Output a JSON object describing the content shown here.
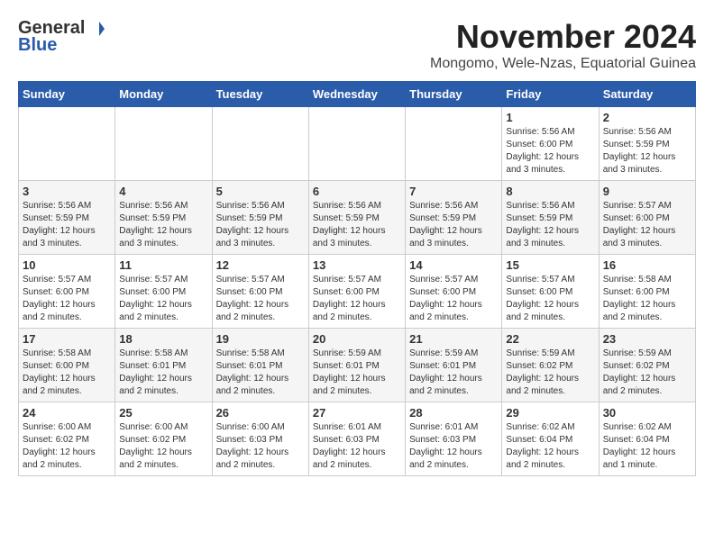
{
  "logo": {
    "general": "General",
    "blue": "Blue"
  },
  "header": {
    "month": "November 2024",
    "location": "Mongomo, Wele-Nzas, Equatorial Guinea"
  },
  "weekdays": [
    "Sunday",
    "Monday",
    "Tuesday",
    "Wednesday",
    "Thursday",
    "Friday",
    "Saturday"
  ],
  "weeks": [
    [
      {
        "day": "",
        "info": ""
      },
      {
        "day": "",
        "info": ""
      },
      {
        "day": "",
        "info": ""
      },
      {
        "day": "",
        "info": ""
      },
      {
        "day": "",
        "info": ""
      },
      {
        "day": "1",
        "info": "Sunrise: 5:56 AM\nSunset: 6:00 PM\nDaylight: 12 hours and 3 minutes."
      },
      {
        "day": "2",
        "info": "Sunrise: 5:56 AM\nSunset: 5:59 PM\nDaylight: 12 hours and 3 minutes."
      }
    ],
    [
      {
        "day": "3",
        "info": "Sunrise: 5:56 AM\nSunset: 5:59 PM\nDaylight: 12 hours and 3 minutes."
      },
      {
        "day": "4",
        "info": "Sunrise: 5:56 AM\nSunset: 5:59 PM\nDaylight: 12 hours and 3 minutes."
      },
      {
        "day": "5",
        "info": "Sunrise: 5:56 AM\nSunset: 5:59 PM\nDaylight: 12 hours and 3 minutes."
      },
      {
        "day": "6",
        "info": "Sunrise: 5:56 AM\nSunset: 5:59 PM\nDaylight: 12 hours and 3 minutes."
      },
      {
        "day": "7",
        "info": "Sunrise: 5:56 AM\nSunset: 5:59 PM\nDaylight: 12 hours and 3 minutes."
      },
      {
        "day": "8",
        "info": "Sunrise: 5:56 AM\nSunset: 5:59 PM\nDaylight: 12 hours and 3 minutes."
      },
      {
        "day": "9",
        "info": "Sunrise: 5:57 AM\nSunset: 6:00 PM\nDaylight: 12 hours and 3 minutes."
      }
    ],
    [
      {
        "day": "10",
        "info": "Sunrise: 5:57 AM\nSunset: 6:00 PM\nDaylight: 12 hours and 2 minutes."
      },
      {
        "day": "11",
        "info": "Sunrise: 5:57 AM\nSunset: 6:00 PM\nDaylight: 12 hours and 2 minutes."
      },
      {
        "day": "12",
        "info": "Sunrise: 5:57 AM\nSunset: 6:00 PM\nDaylight: 12 hours and 2 minutes."
      },
      {
        "day": "13",
        "info": "Sunrise: 5:57 AM\nSunset: 6:00 PM\nDaylight: 12 hours and 2 minutes."
      },
      {
        "day": "14",
        "info": "Sunrise: 5:57 AM\nSunset: 6:00 PM\nDaylight: 12 hours and 2 minutes."
      },
      {
        "day": "15",
        "info": "Sunrise: 5:57 AM\nSunset: 6:00 PM\nDaylight: 12 hours and 2 minutes."
      },
      {
        "day": "16",
        "info": "Sunrise: 5:58 AM\nSunset: 6:00 PM\nDaylight: 12 hours and 2 minutes."
      }
    ],
    [
      {
        "day": "17",
        "info": "Sunrise: 5:58 AM\nSunset: 6:00 PM\nDaylight: 12 hours and 2 minutes."
      },
      {
        "day": "18",
        "info": "Sunrise: 5:58 AM\nSunset: 6:01 PM\nDaylight: 12 hours and 2 minutes."
      },
      {
        "day": "19",
        "info": "Sunrise: 5:58 AM\nSunset: 6:01 PM\nDaylight: 12 hours and 2 minutes."
      },
      {
        "day": "20",
        "info": "Sunrise: 5:59 AM\nSunset: 6:01 PM\nDaylight: 12 hours and 2 minutes."
      },
      {
        "day": "21",
        "info": "Sunrise: 5:59 AM\nSunset: 6:01 PM\nDaylight: 12 hours and 2 minutes."
      },
      {
        "day": "22",
        "info": "Sunrise: 5:59 AM\nSunset: 6:02 PM\nDaylight: 12 hours and 2 minutes."
      },
      {
        "day": "23",
        "info": "Sunrise: 5:59 AM\nSunset: 6:02 PM\nDaylight: 12 hours and 2 minutes."
      }
    ],
    [
      {
        "day": "24",
        "info": "Sunrise: 6:00 AM\nSunset: 6:02 PM\nDaylight: 12 hours and 2 minutes."
      },
      {
        "day": "25",
        "info": "Sunrise: 6:00 AM\nSunset: 6:02 PM\nDaylight: 12 hours and 2 minutes."
      },
      {
        "day": "26",
        "info": "Sunrise: 6:00 AM\nSunset: 6:03 PM\nDaylight: 12 hours and 2 minutes."
      },
      {
        "day": "27",
        "info": "Sunrise: 6:01 AM\nSunset: 6:03 PM\nDaylight: 12 hours and 2 minutes."
      },
      {
        "day": "28",
        "info": "Sunrise: 6:01 AM\nSunset: 6:03 PM\nDaylight: 12 hours and 2 minutes."
      },
      {
        "day": "29",
        "info": "Sunrise: 6:02 AM\nSunset: 6:04 PM\nDaylight: 12 hours and 2 minutes."
      },
      {
        "day": "30",
        "info": "Sunrise: 6:02 AM\nSunset: 6:04 PM\nDaylight: 12 hours and 1 minute."
      }
    ]
  ]
}
